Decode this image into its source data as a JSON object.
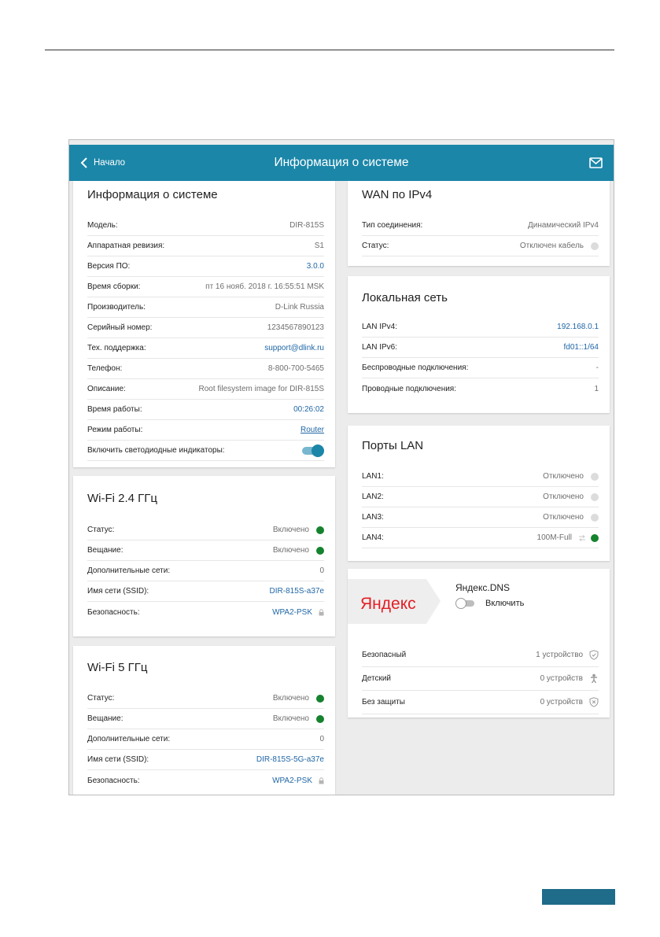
{
  "header": {
    "back_label": "Начало",
    "title": "Информация о системе"
  },
  "system": {
    "title": "Информация о системе",
    "rows": [
      {
        "label": "Модель:",
        "value": "DIR-815S"
      },
      {
        "label": "Аппаратная ревизия:",
        "value": "S1"
      },
      {
        "label": "Версия ПО:",
        "value": "3.0.0"
      },
      {
        "label": "Время сборки:",
        "value": "пт 16 нояб. 2018 г. 16:55:51 MSK"
      },
      {
        "label": "Производитель:",
        "value": "D-Link Russia"
      },
      {
        "label": "Серийный номер:",
        "value": "1234567890123"
      },
      {
        "label": "Тех. поддержка:",
        "value": "support@dlink.ru"
      },
      {
        "label": "Телефон:",
        "value": "8-800-700-5465"
      },
      {
        "label": "Описание:",
        "value": "Root filesystem image for DIR-815S"
      },
      {
        "label": "Время работы:",
        "value": "00:26:02"
      },
      {
        "label": "Режим работы:",
        "value": "Router"
      },
      {
        "label": "Включить светодиодные индикаторы:",
        "value": ""
      }
    ],
    "led_enabled": true
  },
  "wifi24": {
    "title": "Wi-Fi 2.4 ГГц",
    "rows": [
      {
        "label": "Статус:",
        "value": "Включено",
        "status": "green"
      },
      {
        "label": "Вещание:",
        "value": "Включено",
        "status": "green"
      },
      {
        "label": "Дополнительные сети:",
        "value": "0"
      },
      {
        "label": "Имя сети (SSID):",
        "value": "DIR-815S-a37e"
      },
      {
        "label": "Безопасность:",
        "value": "WPA2-PSK"
      }
    ]
  },
  "wifi5": {
    "title": "Wi-Fi 5 ГГц",
    "rows": [
      {
        "label": "Статус:",
        "value": "Включено",
        "status": "green"
      },
      {
        "label": "Вещание:",
        "value": "Включено",
        "status": "green"
      },
      {
        "label": "Дополнительные сети:",
        "value": "0"
      },
      {
        "label": "Имя сети (SSID):",
        "value": "DIR-815S-5G-a37e"
      },
      {
        "label": "Безопасность:",
        "value": "WPA2-PSK"
      }
    ]
  },
  "wan": {
    "title": "WAN по IPv4",
    "rows": [
      {
        "label": "Тип соединения:",
        "value": "Динамический IPv4"
      },
      {
        "label": "Статус:",
        "value": "Отключен кабель",
        "status": "grey"
      }
    ]
  },
  "lan": {
    "title": "Локальная сеть",
    "rows": [
      {
        "label": "LAN IPv4:",
        "value": "192.168.0.1"
      },
      {
        "label": "LAN IPv6:",
        "value": "fd01::1/64"
      },
      {
        "label": "Беспроводные подключения:",
        "value": "-"
      },
      {
        "label": "Проводные подключения:",
        "value": "1"
      }
    ]
  },
  "ports": {
    "title": "Порты LAN",
    "rows": [
      {
        "label": "LAN1:",
        "value": "Отключено",
        "status": "grey"
      },
      {
        "label": "LAN2:",
        "value": "Отключено",
        "status": "grey"
      },
      {
        "label": "LAN3:",
        "value": "Отключено",
        "status": "grey"
      },
      {
        "label": "LAN4:",
        "value": "100M-Full",
        "status": "green"
      }
    ]
  },
  "yandex": {
    "logo_text": "Яндекс",
    "service": "Яндекс.DNS",
    "toggle_label": "Включить",
    "enabled": false,
    "rows": [
      {
        "label": "Безопасный",
        "value": "1 устройство"
      },
      {
        "label": "Детский",
        "value": "0 устройств"
      },
      {
        "label": "Без защиты",
        "value": "0 устройств"
      }
    ]
  },
  "colors": {
    "accent": "#1b86a8",
    "link": "#1f66a6",
    "status_ok": "#15822e",
    "status_off": "#dcdcdc",
    "yandex_red": "#e31e24"
  }
}
